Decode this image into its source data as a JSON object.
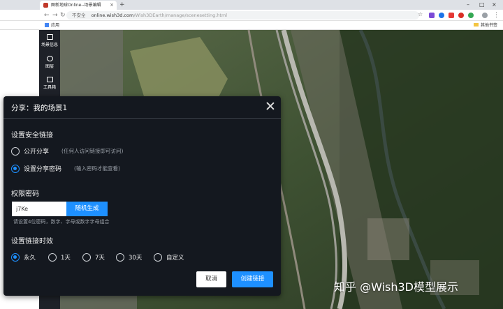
{
  "browser": {
    "tab_title": "图新地球Online--场景编辑",
    "new_tab_symbol": "+",
    "insecure_label": "不安全",
    "url_host": "online.wish3d.com",
    "url_path": "/Wish3DEarth/manage/scenesetting.html",
    "bookmarks_apps": "应用",
    "bookmarks_other": "其他书签"
  },
  "leftnav": {
    "items": [
      {
        "label": "场景信息"
      },
      {
        "label": "图层"
      },
      {
        "label": "工具箱"
      }
    ]
  },
  "dialog": {
    "title": "分享：我的场景1",
    "secure_link_title": "设置安全链接",
    "option_public": "公开分享",
    "option_public_hint": "(任何人访问链接即可访问)",
    "option_password": "设置分享密码",
    "option_password_hint": "(输入密码才能查看)",
    "password_title": "权限密码",
    "password_value": "j7Ke",
    "generate_button": "随机生成",
    "password_help": "请设置4位密码，数字、字母或数字字母组合",
    "expiry_title": "设置链接时效",
    "expiry_options": [
      "永久",
      "1天",
      "7天",
      "30天",
      "自定义"
    ],
    "cancel_button": "取消",
    "create_button": "创建链接"
  },
  "watermark": "知乎 @Wish3D模型展示",
  "colors": {
    "accent": "#1e90ff",
    "dialog_bg": "#14181f",
    "nav_bg": "#1e2128"
  }
}
